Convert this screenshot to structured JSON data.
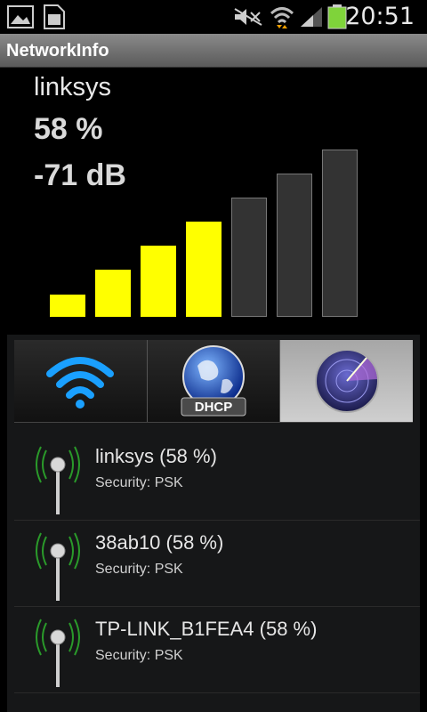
{
  "status_bar": {
    "time": "20:51",
    "icons": [
      "image-icon",
      "sim-card-icon",
      "mute-icon",
      "wifi-icon",
      "cell-signal-icon",
      "battery-icon"
    ]
  },
  "app": {
    "title": "NetworkInfo"
  },
  "signal": {
    "ssid": "linksys",
    "percent": "58 %",
    "strength": "-71 dB",
    "bars_total": 7,
    "bars_lit": 4
  },
  "tabs": [
    {
      "name": "wifi",
      "icon": "wifi-icon",
      "label": ""
    },
    {
      "name": "dhcp",
      "icon": "globe-icon",
      "label": "DHCP"
    },
    {
      "name": "scan",
      "icon": "radar-icon",
      "label": ""
    }
  ],
  "active_tab": "scan",
  "networks": [
    {
      "name": "linksys (58 %)",
      "security": "Security: PSK"
    },
    {
      "name": "38ab10 (58 %)",
      "security": "Security: PSK"
    },
    {
      "name": "TP-LINK_B1FEA4 (58 %)",
      "security": "Security: PSK"
    }
  ],
  "colors": {
    "bar_lit": "#ffff00",
    "bar_unlit": "#333333",
    "battery": "#7fd33a"
  }
}
